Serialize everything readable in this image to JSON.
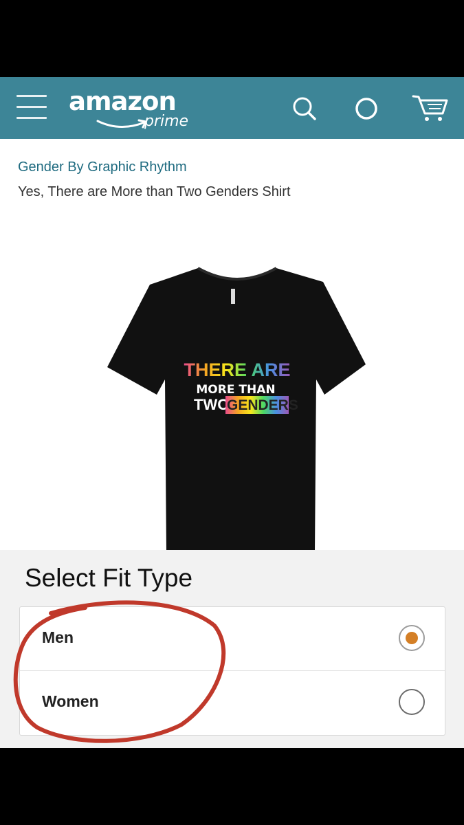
{
  "header": {
    "logo_text": "amazon",
    "logo_sub": "prime",
    "background_color": "#3d8597"
  },
  "product": {
    "brand": "Gender By Graphic Rhythm",
    "title": "Yes, There are More than Two Genders Shirt",
    "shirt_print": {
      "line1": "THERE ARE",
      "line2": "MORE THAN",
      "line3_word1": "TWO",
      "line3_word2": "GENDERS"
    }
  },
  "fit": {
    "heading": "Select Fit Type",
    "options": [
      {
        "label": "Men",
        "selected": true
      },
      {
        "label": "Women",
        "selected": false
      }
    ],
    "selected_color": "#d47f26"
  },
  "annotation": {
    "color": "#c0392b"
  }
}
